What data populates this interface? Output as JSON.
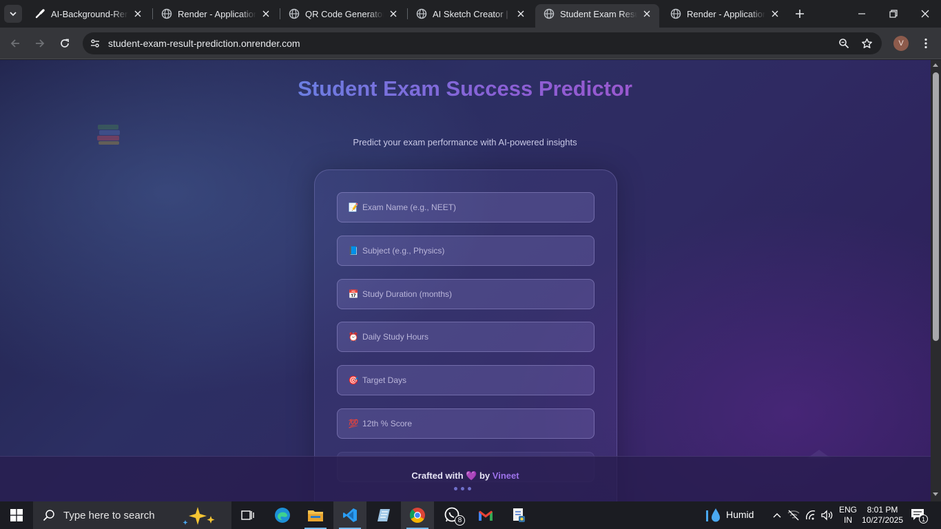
{
  "browser": {
    "tabs": [
      {
        "title": "AI-Background-Remover",
        "favicon": "bg-remover-favicon-icon",
        "active": false
      },
      {
        "title": "Render - Application Dashboard",
        "favicon": "globe-icon",
        "active": false
      },
      {
        "title": "QR Code Generator & Scanner",
        "favicon": "globe-icon",
        "active": false
      },
      {
        "title": "AI Sketch Creator | Vineet",
        "favicon": "globe-icon",
        "active": false
      },
      {
        "title": "Student Exam Result Predictor",
        "favicon": "globe-icon",
        "active": true
      },
      {
        "title": "Render - Application Dashboard",
        "favicon": "globe-icon",
        "active": false
      }
    ],
    "url": "student-exam-result-prediction.onrender.com",
    "profile_initial": "V"
  },
  "page": {
    "title": "Student Exam Success Predictor",
    "subtitle": "Predict your exam performance with AI-powered insights",
    "form_fields": [
      {
        "icon": "📝",
        "placeholder": "Exam Name (e.g., NEET)"
      },
      {
        "icon": "📘",
        "placeholder": "Subject (e.g., Physics)"
      },
      {
        "icon": "📅",
        "placeholder": "Study Duration (months)"
      },
      {
        "icon": "⏰",
        "placeholder": "Daily Study Hours"
      },
      {
        "icon": "🎯",
        "placeholder": "Target Days"
      },
      {
        "icon": "💯",
        "placeholder": "12th % Score"
      }
    ],
    "footer": {
      "prefix": "Crafted with",
      "heart": "💜",
      "by": "by",
      "author": "Vineet"
    }
  },
  "taskbar": {
    "search_placeholder": "Type here to search",
    "whatsapp_badge": "8",
    "weather": "Humid",
    "language": "ENG",
    "region": "IN",
    "time": "8:01 PM",
    "date": "10/27/2025",
    "notification_count": "1"
  }
}
